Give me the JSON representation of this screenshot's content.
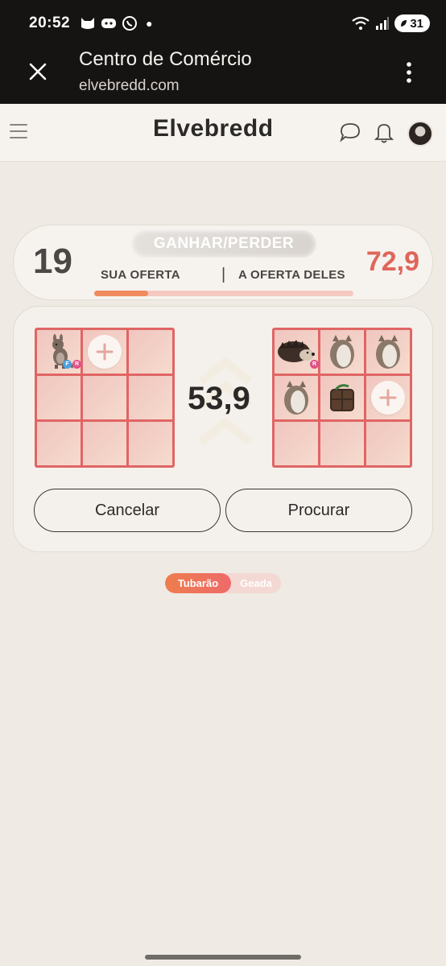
{
  "status_bar": {
    "time": "20:52",
    "battery": "31"
  },
  "custom_tab": {
    "title": "Centro de Comércio",
    "url": "elvebredd.com"
  },
  "site": {
    "logo": "Elvebredd"
  },
  "trade": {
    "your_value": "19",
    "their_value": "72,9",
    "result_label": "GANHAR/PERDER",
    "your_offer_label": "SUA OFERTA",
    "separator": "|",
    "their_offer_label": "A OFERTA DELES",
    "your_share_pct": 20.7,
    "difference": "53,9",
    "your_items": [
      {
        "pet": "kangaroo",
        "tags": [
          "F",
          "R"
        ]
      }
    ],
    "their_items": [
      {
        "pet": "hedgehog",
        "tags": [
          "R"
        ]
      },
      {
        "pet": "egg"
      },
      {
        "pet": "egg"
      },
      {
        "pet": "egg"
      },
      {
        "pet": "wooden-box"
      }
    ],
    "cancel_label": "Cancelar",
    "search_label": "Procurar"
  },
  "mode_toggle": {
    "active": "Tubarão",
    "inactive": "Geada"
  },
  "colors": {
    "accent_red": "#e0665a",
    "grid_border": "#e06565",
    "toggle_orange": "#ee7d4d"
  },
  "icons": [
    "close-icon",
    "more-vert-icon",
    "menu-icon",
    "chat-icon",
    "bell-icon",
    "plus-icon",
    "wifi-icon",
    "signal-icon"
  ]
}
